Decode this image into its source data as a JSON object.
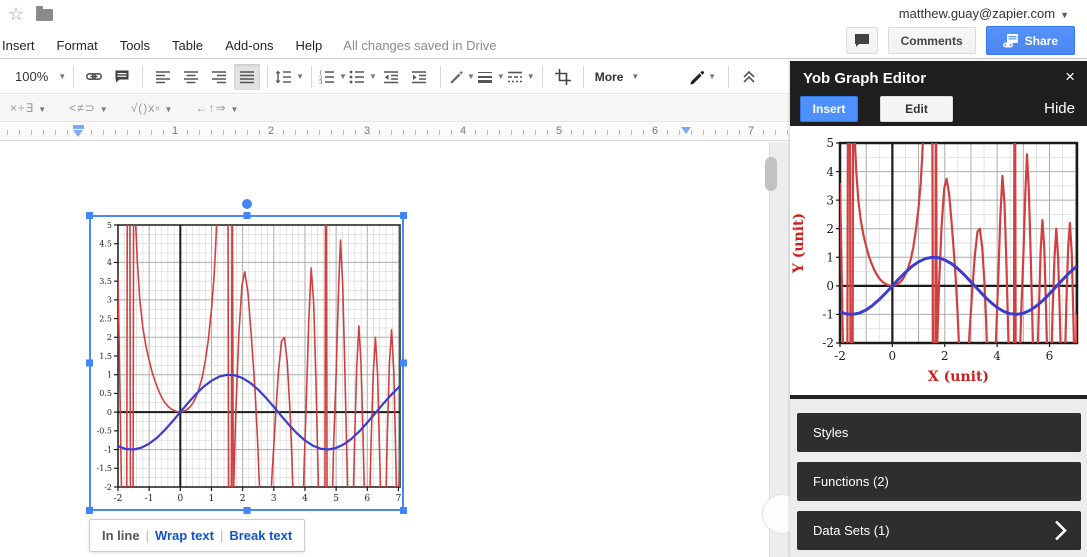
{
  "titlebar": {
    "email": "matthew.guay@zapier.com",
    "comments_label": "Comments",
    "share_label": "Share"
  },
  "menubar": {
    "items": [
      "Insert",
      "Format",
      "Tools",
      "Table",
      "Add-ons",
      "Help"
    ],
    "status": "All changes saved in Drive"
  },
  "toolbar": {
    "zoom_value": "100%",
    "more_label": "More"
  },
  "equation_bar": {
    "groups": [
      "×÷∃",
      "<≠⊃",
      "√()x▫",
      "←↑⇒"
    ]
  },
  "ruler": {
    "numbers": [
      "1",
      "2",
      "3",
      "4",
      "5",
      "6",
      "7"
    ]
  },
  "image_options": {
    "inline": "In line",
    "wrap": "Wrap text",
    "break": "Break text",
    "separator": "|"
  },
  "panel": {
    "title": "Yob Graph Editor",
    "close": "×",
    "insert_label": "Insert",
    "edit_label": "Edit",
    "hide_label": "Hide",
    "sections": [
      {
        "label": "Styles",
        "chevron": false
      },
      {
        "label": "Functions (2)",
        "chevron": false
      },
      {
        "label": "Data Sets (1)",
        "chevron": true
      }
    ]
  },
  "colors": {
    "accent_blue": "#4d90fe",
    "selection_blue": "#4285f4",
    "curve_red": "#cf4040",
    "curve_blue": "#3c3ccd",
    "axis_label_red": "#cc1f1f"
  },
  "chart_data": {
    "type": "line",
    "x_range": [
      -2,
      7.05
    ],
    "y_range": [
      -2,
      5
    ],
    "document_graph": {
      "x_ticks": [
        -2,
        -1,
        0,
        1,
        2,
        3,
        4,
        5,
        6,
        7
      ],
      "y_ticks": [
        -2,
        -1.5,
        -1,
        -0.5,
        0,
        0.5,
        1,
        1.5,
        2,
        2.5,
        3,
        3.5,
        4,
        4.5,
        5
      ]
    },
    "panel_graph": {
      "x_ticks": [
        -2,
        0,
        2,
        4,
        6
      ],
      "y_ticks": [
        -2,
        -1,
        0,
        1,
        2,
        3,
        4,
        5
      ],
      "x_label": "X (unit)",
      "y_label": "Y (unit)"
    },
    "series": [
      {
        "id": "f1",
        "color": "#cf4040",
        "points": [
          [
            -2,
            3.6
          ],
          [
            -1.96,
            1.8
          ],
          [
            -1.93,
            0.2
          ],
          [
            -1.9,
            -1.4
          ],
          [
            -1.87,
            -3
          ],
          [
            -1.72,
            -3
          ],
          [
            -1.7,
            5.6
          ],
          [
            -1.62,
            5.6
          ],
          [
            -1.6,
            -3
          ],
          [
            -1.52,
            -3
          ],
          [
            -1.5,
            5.6
          ],
          [
            -1.44,
            5.2
          ],
          [
            -1.38,
            4.05
          ],
          [
            -1.3,
            3.0
          ],
          [
            -1.2,
            2.25
          ],
          [
            -1.1,
            1.75
          ],
          [
            -1.0,
            1.38
          ],
          [
            -0.9,
            1.05
          ],
          [
            -0.8,
            0.8
          ],
          [
            -0.7,
            0.58
          ],
          [
            -0.6,
            0.4
          ],
          [
            -0.5,
            0.26
          ],
          [
            -0.4,
            0.16
          ],
          [
            -0.3,
            0.09
          ],
          [
            -0.2,
            0.04
          ],
          [
            -0.1,
            0.01
          ],
          [
            0,
            0
          ],
          [
            0.1,
            0.02
          ],
          [
            0.2,
            0.06
          ],
          [
            0.3,
            0.13
          ],
          [
            0.4,
            0.24
          ],
          [
            0.5,
            0.4
          ],
          [
            0.6,
            0.62
          ],
          [
            0.7,
            0.92
          ],
          [
            0.8,
            1.35
          ],
          [
            0.9,
            1.95
          ],
          [
            1.0,
            2.75
          ],
          [
            1.08,
            3.6
          ],
          [
            1.14,
            4.5
          ],
          [
            1.19,
            5.6
          ],
          [
            1.53,
            5.6
          ],
          [
            1.55,
            -3
          ],
          [
            1.64,
            -3
          ],
          [
            1.66,
            5.6
          ],
          [
            1.67,
            5.6
          ],
          [
            1.7,
            -2.4
          ],
          [
            1.78,
            0
          ],
          [
            1.88,
            2.1
          ],
          [
            1.98,
            3.4
          ],
          [
            2.07,
            3.75
          ],
          [
            2.17,
            3.2
          ],
          [
            2.28,
            2.0
          ],
          [
            2.4,
            0.55
          ],
          [
            2.47,
            -0.6
          ],
          [
            2.54,
            -2.0
          ],
          [
            2.58,
            -3
          ],
          [
            2.86,
            -3
          ],
          [
            2.95,
            -1.6
          ],
          [
            3.05,
            -0.2
          ],
          [
            3.15,
            1.1
          ],
          [
            3.25,
            1.9
          ],
          [
            3.34,
            2.0
          ],
          [
            3.43,
            1.35
          ],
          [
            3.51,
            0.2
          ],
          [
            3.58,
            -1.2
          ],
          [
            3.63,
            -2.6
          ],
          [
            3.66,
            -3
          ],
          [
            3.92,
            -3
          ],
          [
            3.98,
            -1.3
          ],
          [
            4.04,
            0.2
          ],
          [
            4.12,
            2.4
          ],
          [
            4.2,
            3.85
          ],
          [
            4.28,
            2.9
          ],
          [
            4.35,
            0.9
          ],
          [
            4.41,
            -1.2
          ],
          [
            4.46,
            -3
          ],
          [
            4.64,
            -3
          ],
          [
            4.66,
            5.6
          ],
          [
            4.69,
            5.6
          ],
          [
            4.71,
            -3
          ],
          [
            4.86,
            -3
          ],
          [
            4.92,
            -0.9
          ],
          [
            5.0,
            1.0
          ],
          [
            5.08,
            3.3
          ],
          [
            5.14,
            4.6
          ],
          [
            5.21,
            3.4
          ],
          [
            5.28,
            1.2
          ],
          [
            5.34,
            -1.0
          ],
          [
            5.39,
            -3
          ],
          [
            5.53,
            -3
          ],
          [
            5.59,
            -0.9
          ],
          [
            5.66,
            1.2
          ],
          [
            5.73,
            2.3
          ],
          [
            5.8,
            1.3
          ],
          [
            5.86,
            -0.5
          ],
          [
            5.91,
            -2.3
          ],
          [
            5.94,
            -3
          ],
          [
            6.06,
            -3
          ],
          [
            6.12,
            -0.9
          ],
          [
            6.19,
            1.0
          ],
          [
            6.26,
            2.0
          ],
          [
            6.33,
            1.0
          ],
          [
            6.39,
            -0.9
          ],
          [
            6.44,
            -2.6
          ],
          [
            6.46,
            -3
          ],
          [
            6.58,
            -3
          ],
          [
            6.64,
            -0.7
          ],
          [
            6.71,
            1.3
          ],
          [
            6.78,
            2.2
          ],
          [
            6.85,
            1.1
          ],
          [
            6.91,
            -1.0
          ],
          [
            6.95,
            -2.7
          ],
          [
            6.97,
            -3
          ],
          [
            7.0,
            -3
          ],
          [
            7.05,
            -1.0
          ]
        ]
      },
      {
        "id": "f2",
        "color": "#3c3ccd",
        "points": [
          [
            -2,
            -0.909
          ],
          [
            -1.75,
            -0.984
          ],
          [
            -1.5,
            -0.997
          ],
          [
            -1.25,
            -0.949
          ],
          [
            -1,
            -0.841
          ],
          [
            -0.75,
            -0.682
          ],
          [
            -0.5,
            -0.479
          ],
          [
            -0.25,
            -0.247
          ],
          [
            0,
            0
          ],
          [
            0.25,
            0.247
          ],
          [
            0.5,
            0.479
          ],
          [
            0.75,
            0.682
          ],
          [
            1,
            0.841
          ],
          [
            1.25,
            0.949
          ],
          [
            1.5,
            0.997
          ],
          [
            1.75,
            0.984
          ],
          [
            2,
            0.909
          ],
          [
            2.25,
            0.778
          ],
          [
            2.5,
            0.599
          ],
          [
            2.75,
            0.382
          ],
          [
            3,
            0.141
          ],
          [
            3.25,
            -0.108
          ],
          [
            3.5,
            -0.351
          ],
          [
            3.75,
            -0.572
          ],
          [
            4,
            -0.757
          ],
          [
            4.25,
            -0.895
          ],
          [
            4.5,
            -0.978
          ],
          [
            4.75,
            -0.999
          ],
          [
            5,
            -0.959
          ],
          [
            5.25,
            -0.859
          ],
          [
            5.5,
            -0.706
          ],
          [
            5.75,
            -0.508
          ],
          [
            6,
            -0.279
          ],
          [
            6.25,
            -0.033
          ],
          [
            6.5,
            0.215
          ],
          [
            6.75,
            0.45
          ],
          [
            7,
            0.657
          ],
          [
            7.05,
            0.693
          ]
        ]
      }
    ]
  }
}
